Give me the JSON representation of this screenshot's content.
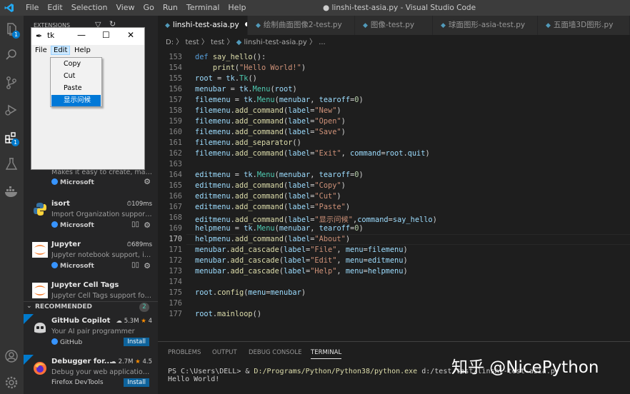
{
  "titlebar": {
    "menu": [
      "File",
      "Edit",
      "Selection",
      "View",
      "Go",
      "Run",
      "Terminal",
      "Help"
    ],
    "window_title": "● linshi-test-asia.py - Visual Studio Code"
  },
  "activity": {
    "extensions_badge": "1",
    "scm_badge": "1"
  },
  "sidebar": {
    "header": "EXTENSIONS",
    "partial_item": {
      "desc": "Makes it easy to create, man...",
      "publisher": "Microsoft"
    },
    "installed": [
      {
        "name": "isort",
        "meta": "⏱109ms",
        "desc": "Import Organization support...",
        "publisher": "Microsoft"
      },
      {
        "name": "Jupyter",
        "meta": "⏱689ms",
        "desc": "Jupyter notebook support, in...",
        "publisher": "Microsoft"
      },
      {
        "name": "Jupyter Cell Tags",
        "meta": "",
        "desc": "Jupyter Cell Tags support for...",
        "publisher": "Microsoft"
      }
    ],
    "recommended_header": "RECOMMENDED",
    "recommended_count": "2",
    "recommended": [
      {
        "name": "GitHub Copilot",
        "downloads": "5.3M",
        "rating": "4",
        "desc": "Your AI pair programmer",
        "publisher": "GitHub",
        "install": "Install"
      },
      {
        "name": "Debugger for...",
        "downloads": "2.7M",
        "rating": "4.5",
        "desc": "Debug your web application ...",
        "publisher": "Firefox DevTools",
        "install": "Install"
      }
    ]
  },
  "tkwindow": {
    "title": "tk",
    "menu": [
      "File",
      "Edit",
      "Help"
    ],
    "dropdown": [
      "Copy",
      "Cut",
      "Paste",
      "显示问候"
    ]
  },
  "editor": {
    "tabs": [
      {
        "label": "linshi-test-asia.py"
      },
      {
        "label": "绘制曲面图像2-test.py"
      },
      {
        "label": "图像-test.py"
      },
      {
        "label": "球面图形-asia-test.py"
      },
      {
        "label": "五面墙3D图形.py"
      }
    ],
    "breadcrumb": [
      "D:",
      "test",
      "test",
      "linshi-test-asia.py",
      "..."
    ],
    "current_line": "170",
    "lines": [
      {
        "no": "153",
        "text": "def say_hello():"
      },
      {
        "no": "154",
        "text": "    print(\"Hello World!\")"
      },
      {
        "no": "155",
        "text": "root = tk.Tk()"
      },
      {
        "no": "156",
        "text": "menubar = tk.Menu(root)"
      },
      {
        "no": "157",
        "text": "filemenu = tk.Menu(menubar, tearoff=0)"
      },
      {
        "no": "158",
        "text": "filemenu.add_command(label=\"New\")"
      },
      {
        "no": "159",
        "text": "filemenu.add_command(label=\"Open\")"
      },
      {
        "no": "160",
        "text": "filemenu.add_command(label=\"Save\")"
      },
      {
        "no": "161",
        "text": "filemenu.add_separator()"
      },
      {
        "no": "162",
        "text": "filemenu.add_command(label=\"Exit\", command=root.quit)"
      },
      {
        "no": "163",
        "text": ""
      },
      {
        "no": "164",
        "text": "editmenu = tk.Menu(menubar, tearoff=0)"
      },
      {
        "no": "165",
        "text": "editmenu.add_command(label=\"Copy\")"
      },
      {
        "no": "166",
        "text": "editmenu.add_command(label=\"Cut\")"
      },
      {
        "no": "167",
        "text": "editmenu.add_command(label=\"Paste\")"
      },
      {
        "no": "168",
        "text": "editmenu.add_command(label=\"显示问候\",command=say_hello)"
      },
      {
        "no": "169",
        "text": "helpmenu = tk.Menu(menubar, tearoff=0)"
      },
      {
        "no": "170",
        "text": "helpmenu.add_command(label=\"About\")"
      },
      {
        "no": "171",
        "text": "menubar.add_cascade(label=\"File\", menu=filemenu)"
      },
      {
        "no": "172",
        "text": "menubar.add_cascade(label=\"Edit\", menu=editmenu)"
      },
      {
        "no": "173",
        "text": "menubar.add_cascade(label=\"Help\", menu=helpmenu)"
      },
      {
        "no": "174",
        "text": ""
      },
      {
        "no": "175",
        "text": "root.config(menu=menubar)"
      },
      {
        "no": "176",
        "text": ""
      },
      {
        "no": "177",
        "text": "root.mainloop()"
      }
    ]
  },
  "panel": {
    "tabs": [
      "PROBLEMS",
      "OUTPUT",
      "DEBUG CONSOLE",
      "TERMINAL"
    ],
    "active_tab": "TERMINAL",
    "prompt": "PS C:\\Users\\DELL> & ",
    "exe": "D:/Programs/Python/Python38/python.exe",
    "arg": " d:/test/test/linshi-test-asia.py",
    "output": "Hello World!"
  },
  "watermark": "知乎 @NicePython",
  "colors": {
    "accent": "#007acc",
    "keyword": "#569cd6",
    "function": "#dcdcaa",
    "variable": "#9cdcfe",
    "string": "#ce9178",
    "number": "#b5cea8"
  }
}
